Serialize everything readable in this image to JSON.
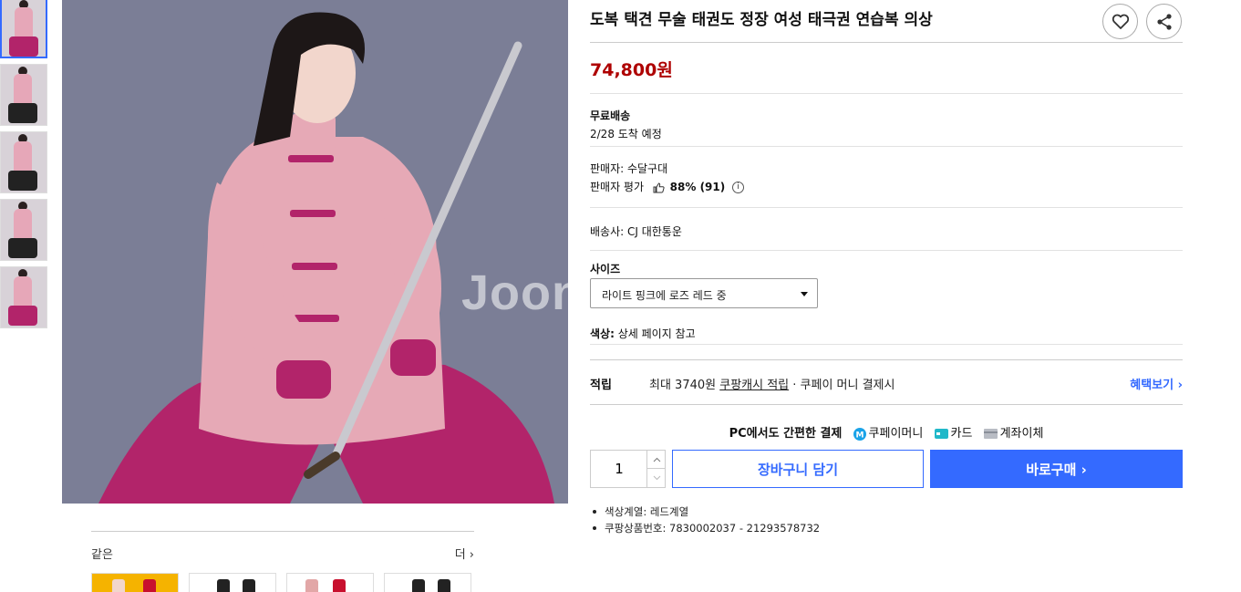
{
  "product": {
    "title": "도복 택견 무술 태권도 정장 여성 태극권 연습복 의상",
    "price": "74,800원",
    "image_watermark": "Joon"
  },
  "shipping": {
    "label": "무료배송",
    "arrival": "2/28 도착 예정"
  },
  "seller": {
    "seller_line": "판매자: 수달구대",
    "rating_label": "판매자 평가",
    "rating_value": "88% (91)"
  },
  "carrier": "배송사: CJ 대한통운",
  "options": {
    "size_label": "사이즈",
    "size_selected": "라이트 핑크에 로즈 레드 중",
    "color_label": "색상:",
    "color_value": "상세 페이지 참고"
  },
  "reward": {
    "label": "적립",
    "text_before": "최대 3740원 ",
    "text_link": "쿠팡캐시 적립",
    "text_after": " · 쿠페이 머니 결제시",
    "benefit_link": "혜택보기 ›"
  },
  "payment": {
    "pc_label": "PC에서도 간편한 결제",
    "methods": [
      "쿠페이머니",
      "카드",
      "계좌이체"
    ]
  },
  "purchase": {
    "quantity": "1",
    "cart_label": "장바구니 담기",
    "buy_label": "바로구매 ›"
  },
  "details": [
    "색상계열: 레드계열",
    "쿠팡상품번호: 7830002037 - 21293578732"
  ],
  "same_products": {
    "label": "같은",
    "more": "더 ›"
  },
  "colors": {
    "accent": "#346aff",
    "price": "#ae0000",
    "image_background": "#7b7e96"
  }
}
